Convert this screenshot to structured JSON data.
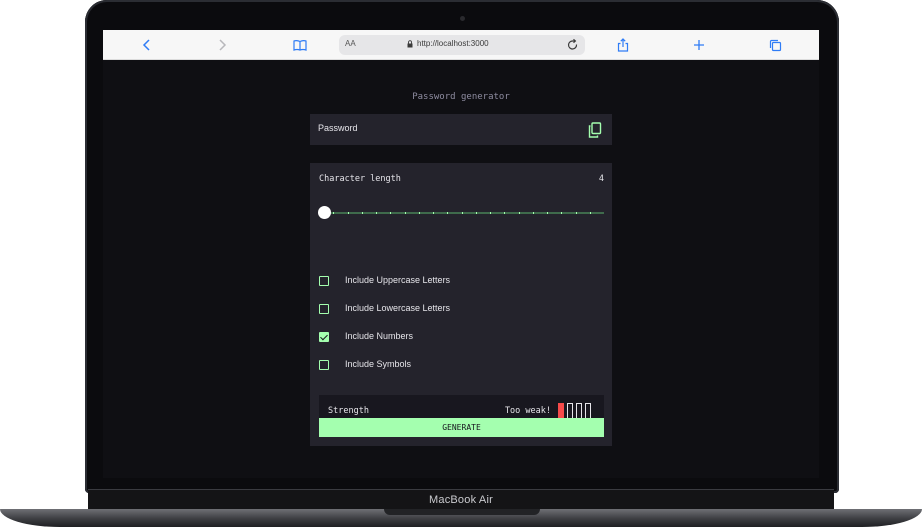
{
  "device": {
    "label": "MacBook Air"
  },
  "browser": {
    "address": {
      "text_size_label": "AA",
      "url": "http://localhost:3000"
    },
    "icons": [
      "back-icon",
      "forward-icon",
      "bookmarks-icon",
      "lock-icon",
      "reload-icon",
      "share-icon",
      "new-tab-icon",
      "tabs-icon"
    ]
  },
  "app": {
    "title": "Password generator",
    "password": {
      "value": "Password"
    },
    "length": {
      "label": "Character length",
      "value": "4",
      "min": 0,
      "max": 20,
      "current": 0
    },
    "options": [
      {
        "label": "Include Uppercase Letters",
        "checked": false
      },
      {
        "label": "Include Lowercase Letters",
        "checked": false
      },
      {
        "label": "Include Numbers",
        "checked": true
      },
      {
        "label": "Include Symbols",
        "checked": false
      }
    ],
    "strength": {
      "label": "Strength",
      "value": "Too weak!",
      "level": 1,
      "max_level": 4
    },
    "generate_label": "GENERATE"
  },
  "colors": {
    "accent": "#a4ffaf",
    "panel": "#24232c",
    "background": "#0f0f13",
    "strength_weak": "#f64a4a",
    "text": "#e6e5ea"
  }
}
